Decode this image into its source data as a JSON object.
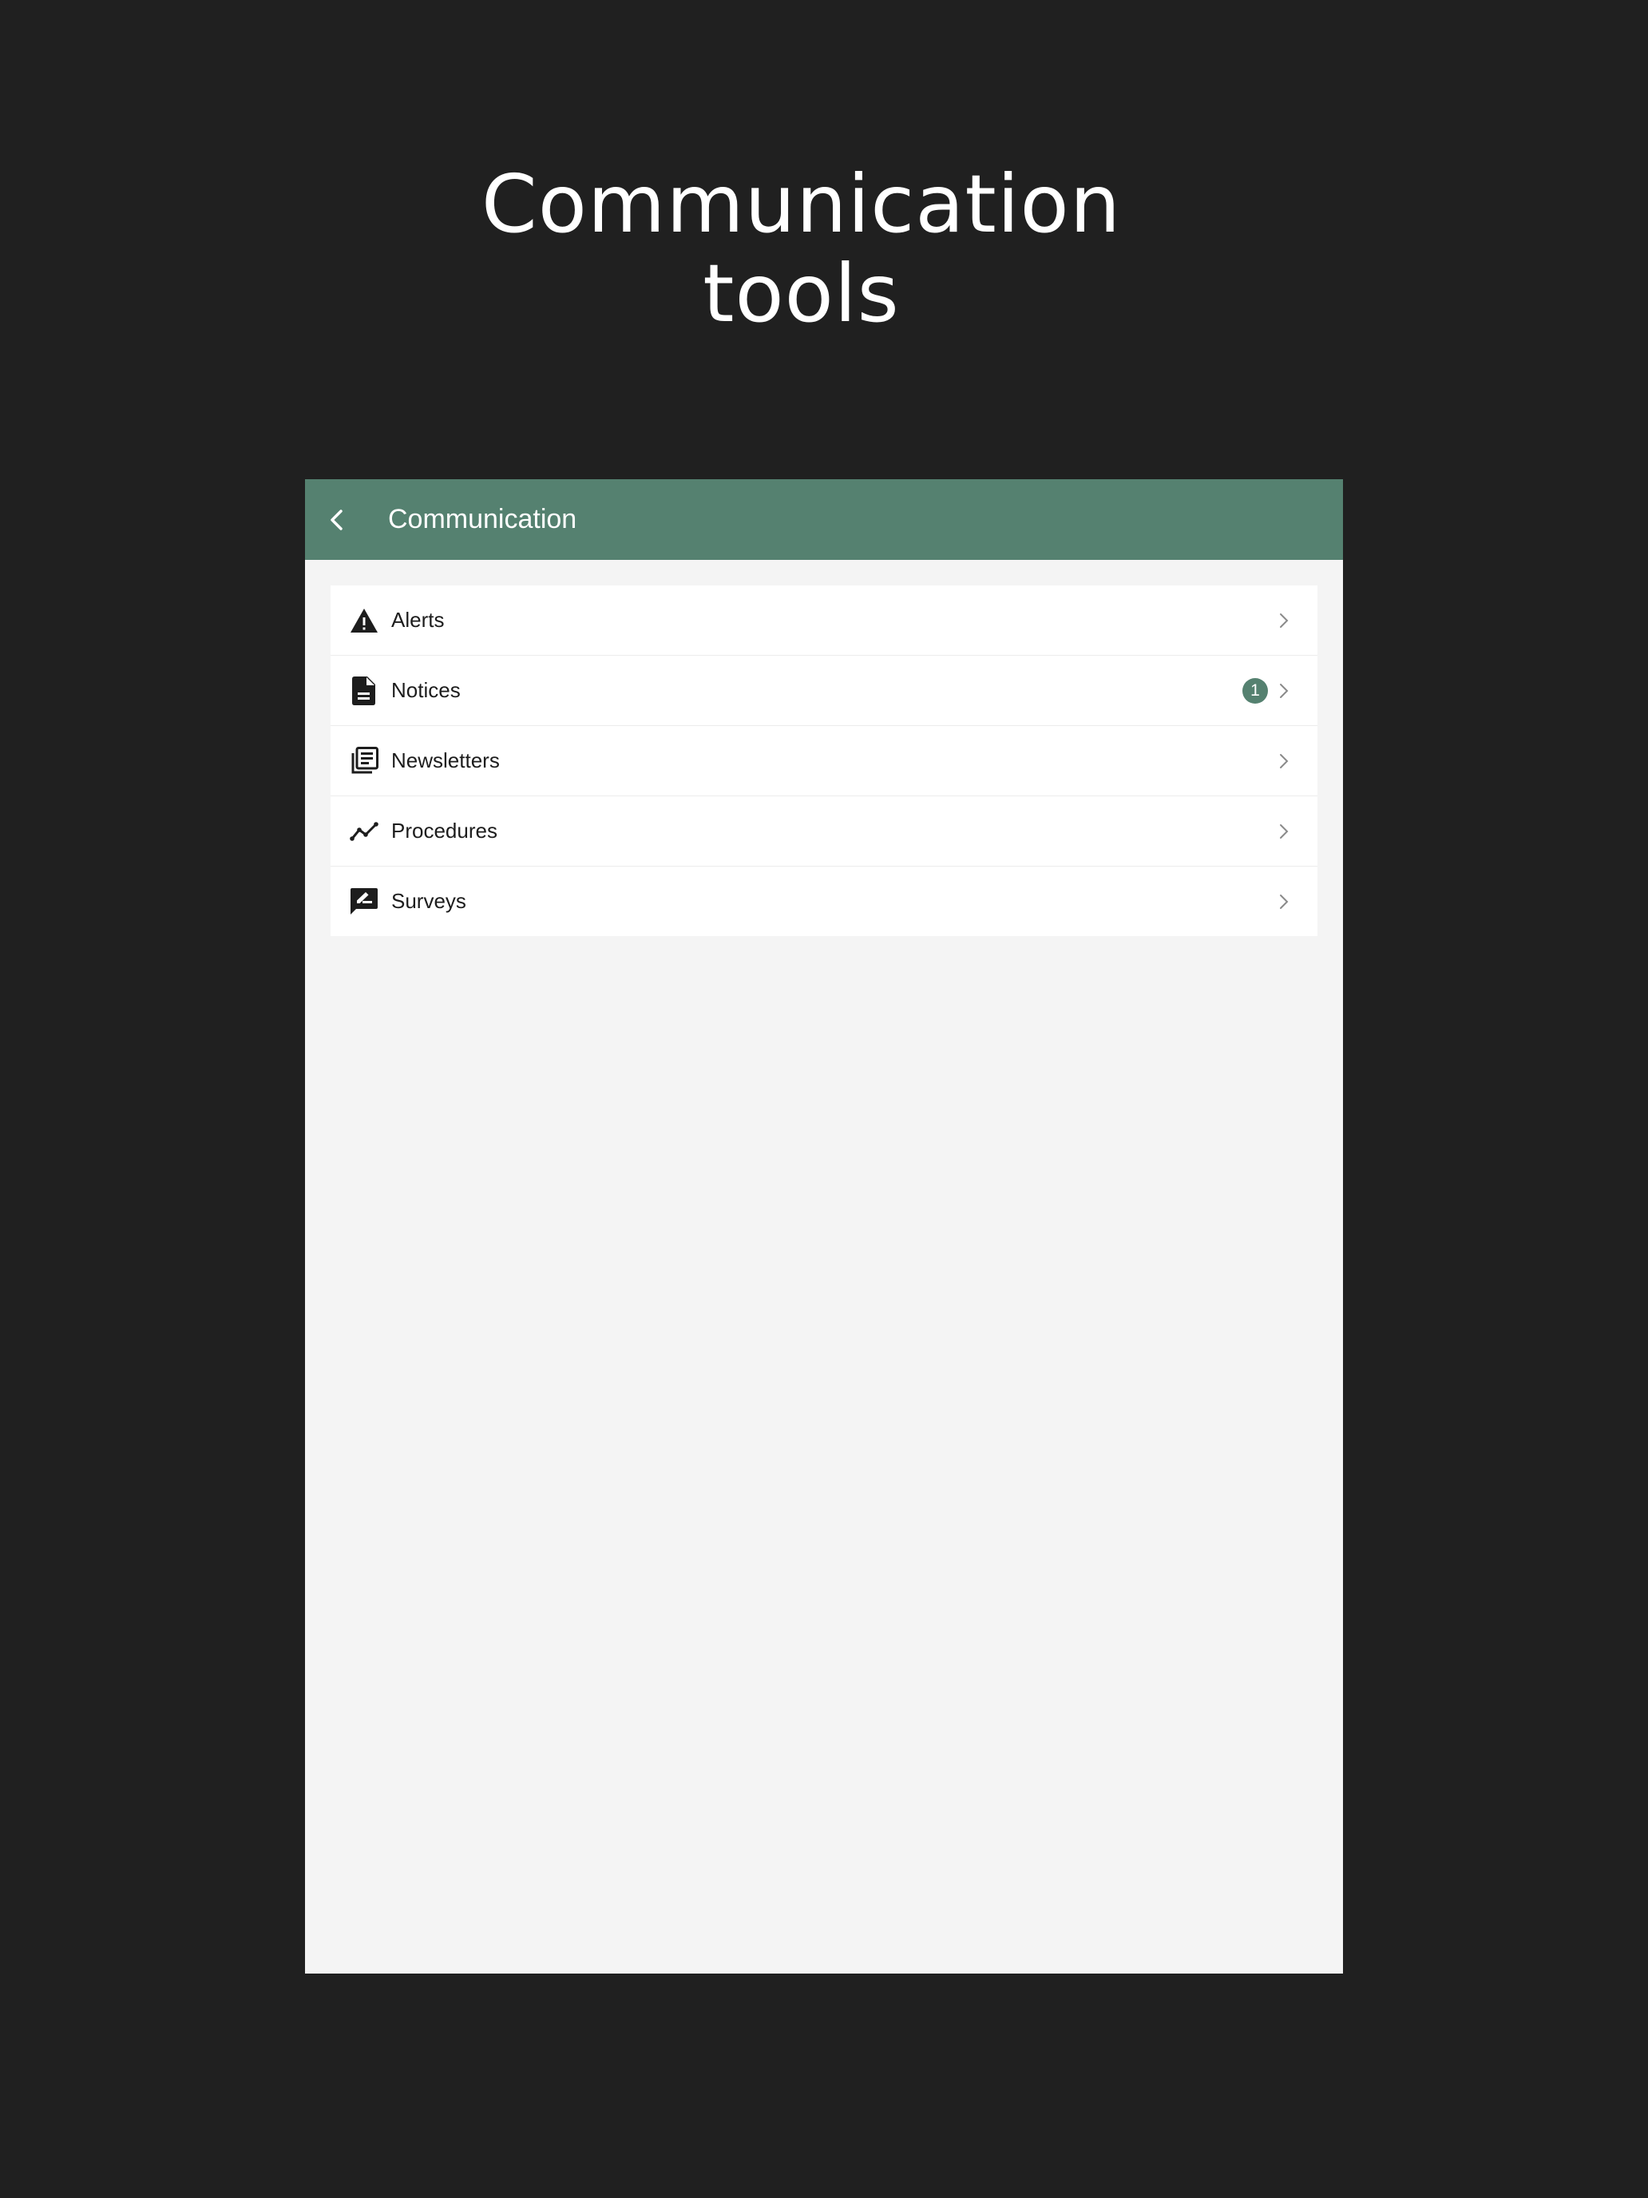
{
  "headline": {
    "line1": "Communication",
    "line2": "tools"
  },
  "appbar": {
    "title": "Communication",
    "back_icon": "chevron-left-icon"
  },
  "colors": {
    "accent": "#558170",
    "page_bg": "#202020",
    "content_bg": "#f4f4f4"
  },
  "menu": {
    "items": [
      {
        "label": "Alerts",
        "icon": "warning-icon",
        "badge": ""
      },
      {
        "label": "Notices",
        "icon": "document-icon",
        "badge": "1"
      },
      {
        "label": "Newsletters",
        "icon": "newspaper-icon",
        "badge": ""
      },
      {
        "label": "Procedures",
        "icon": "trend-line-icon",
        "badge": ""
      },
      {
        "label": "Surveys",
        "icon": "rate-review-icon",
        "badge": ""
      }
    ]
  }
}
